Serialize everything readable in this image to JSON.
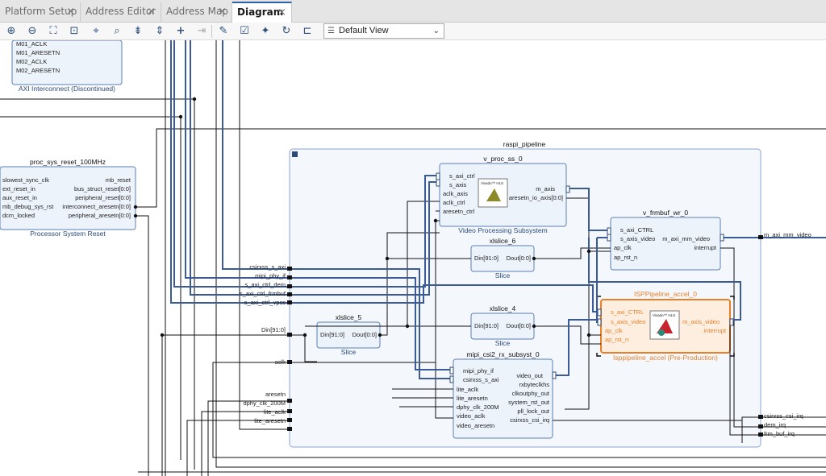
{
  "tabs": [
    {
      "label": "Platform Setup"
    },
    {
      "label": "Address Editor"
    },
    {
      "label": "Address Map"
    },
    {
      "label": "Diagram"
    }
  ],
  "toolbar": {
    "view_select": "Default View",
    "icons": [
      "zoom-in-icon",
      "zoom-out-icon",
      "zoom-fit-icon",
      "fit-selection-icon",
      "center-icon",
      "search-icon",
      "collapse-all-icon",
      "expand-all-icon",
      "add-ip-icon",
      "make-external-icon",
      "properties-icon",
      "validate-icon",
      "run-connection-icon",
      "regenerate-layout-icon",
      "optimize-routing-icon"
    ]
  },
  "diagram": {
    "axi_interconnect": {
      "ports": [
        "M01_ACLK",
        "M01_ARESETN",
        "M02_ACLK",
        "M02_ARESETN"
      ],
      "caption": "AXI Interconnect (Discontinued)"
    },
    "proc_sys_reset": {
      "name": "proc_sys_reset_100MHz",
      "inputs": [
        "slowest_sync_clk",
        "ext_reset_in",
        "aux_reset_in",
        "mb_debug_sys_rst",
        "dcm_locked"
      ],
      "outputs": [
        "mb_reset",
        "bus_struct_reset[0:0]",
        "peripheral_reset[0:0]",
        "interconnect_aresetn[0:0]",
        "peripheral_aresetn[0:0]"
      ],
      "caption": "Processor System Reset"
    },
    "hier": {
      "name": "raspi_pipeline",
      "left_pins": [
        "csirxss_s_axi",
        "mipi_phy_if",
        "s_axi_ctrl_dem",
        "s_axi_ctrl_frmbuf",
        "s_axi_ctrl_vpss",
        "Din[91:0]",
        "aclk",
        "aresetn",
        "dphy_clk_200M",
        "lite_aclk",
        "lite_aresetn"
      ],
      "right_pins": [
        "m_axi_mm_video",
        "csirxss_csi_irq",
        "dem_irq",
        "frm_buf_irq"
      ]
    },
    "v_proc_ss": {
      "name": "v_proc_ss_0",
      "inputs": [
        "s_axi_ctrl",
        "s_axis",
        "aclk_axis",
        "aclk_ctrl",
        "aresetn_ctrl"
      ],
      "outputs": [
        "m_axis",
        "aresetn_io_axis[0:0]"
      ],
      "logo": "Vivado™ HLS",
      "caption": "Video Processing Subsystem"
    },
    "v_frmbuf": {
      "name": "v_frmbuf_wr_0",
      "inputs": [
        "s_axi_CTRL",
        "s_axis_video",
        "ap_clk",
        "ap_rst_n"
      ],
      "outputs": [
        "m_axi_mm_video",
        "interrupt"
      ]
    },
    "xlslice_6": {
      "name": "xlslice_6",
      "in": "Din[91:0]",
      "out": "Dout[0:0]",
      "caption": "Slice"
    },
    "xlslice_5": {
      "name": "xlslice_5",
      "in": "Din[91:0]",
      "out": "Dout[0:0]",
      "caption": "Slice"
    },
    "xlslice_4": {
      "name": "xlslice_4",
      "in": "Din[91:0]",
      "out": "Dout[0:0]",
      "caption": "Slice"
    },
    "isp": {
      "name": "ISPPipeline_accel_0",
      "inputs": [
        "s_axi_CTRL",
        "s_axis_video",
        "ap_clk",
        "ap_rst_n"
      ],
      "outputs": [
        "m_axis_video",
        "interrupt"
      ],
      "logo": "Vivado™ HLS",
      "caption": "Isppipeline_accel (Pre-Production)"
    },
    "mipi": {
      "name": "mipi_csi2_rx_subsyst_0",
      "inputs": [
        "mipi_phy_if",
        "csirxss_s_axi",
        "lite_aclk",
        "lite_aresetn",
        "dphy_clk_200M",
        "video_aclk",
        "video_aresetn"
      ],
      "outputs": [
        "video_out",
        "rxbyteclkhs",
        "clkoutphy_out",
        "system_rst_out",
        "pll_lock_out",
        "csirxss_csi_irq"
      ]
    },
    "ext_right": [
      "m_axi_mm_video",
      "csirxss_csi_irq",
      "dem_irq",
      "frm_buf_irq"
    ],
    "colors": {
      "block_border": "#5b7fb5",
      "block_fill": "#edf3fb",
      "hier_fill": "#f4f8fd",
      "bus": "#3a5a98",
      "net": "#111111",
      "highlight": "#e8802a",
      "highlight_fill": "#fdeee0"
    }
  }
}
